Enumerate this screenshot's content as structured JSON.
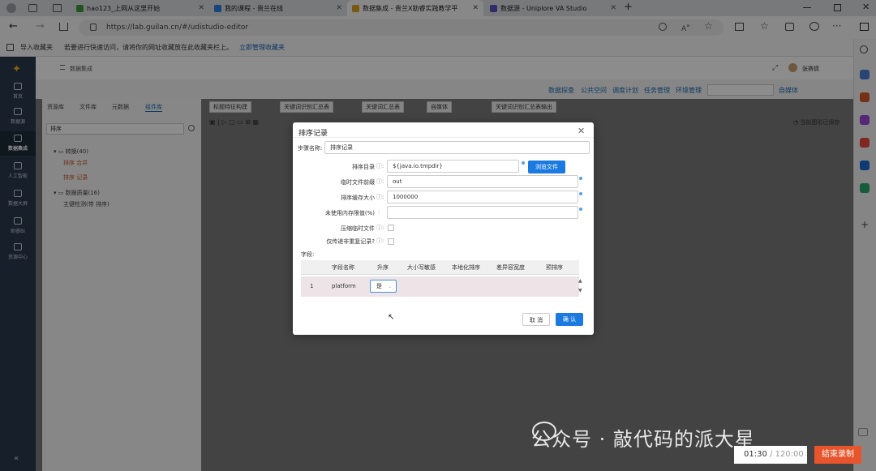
{
  "browser": {
    "tabs": [
      {
        "label": "",
        "active": false
      },
      {
        "label": "hao123_上网从这里开始",
        "active": false
      },
      {
        "label": "我的课程 - 贵兰在线",
        "active": false
      },
      {
        "label": "数据集成 - 贵兰X助睿实践教学平",
        "active": true
      },
      {
        "label": "数据源 - Uniplore VA Studio",
        "active": false
      }
    ],
    "new_tab": "+",
    "url": "https://lab.guilan.cn/#/udistudio-editor",
    "favbar": {
      "import": "导入收藏夹",
      "hint": "若要进行快速访问，请将你的网址收藏放在此收藏夹栏上。",
      "link": "立即管理收藏夹"
    }
  },
  "app": {
    "breadcrumb": "数据集成",
    "user": "张赛倩",
    "nav": [
      {
        "label": "首页"
      },
      {
        "label": "数据源"
      },
      {
        "label": "数据集成",
        "active": true
      },
      {
        "label": "人工智能"
      },
      {
        "label": "数据大屏"
      },
      {
        "label": "助睿BI"
      },
      {
        "label": "资源中心"
      }
    ],
    "menu": [
      "数据探查",
      "公共空间",
      "调度计划",
      "任务管理",
      "环境管理"
    ],
    "media": "自媒体",
    "left_tabs": [
      "资源库",
      "文件库",
      "元数据",
      "组件库"
    ],
    "search_value": "排序",
    "tree": {
      "group1": "转换(40)",
      "g1_items": [
        "排序 合并",
        "排序 记录"
      ],
      "group2": "数据质量(16)",
      "g2_items": [
        "主键检测(带 排序)"
      ]
    },
    "doc_tabs": [
      "标题特征构建",
      "关键词识别汇总表",
      "关键词汇总表",
      "自媒体",
      "关键词识别汇总表输出"
    ],
    "save_status": "当前图形已保存"
  },
  "dialog": {
    "title": "排序记录",
    "step_label": "步骤名称:",
    "step_value": "排序记录",
    "fields": [
      {
        "label": "排序目录",
        "value": "${java.io.tmpdir}"
      },
      {
        "label": "临时文件前缀",
        "value": "out"
      },
      {
        "label": "排序缓存大小",
        "value": "1000000"
      },
      {
        "label": "未使用内存限值(%)",
        "value": ""
      }
    ],
    "browse": "浏览文件",
    "checks": [
      "压缩临时文件",
      "仅传递非重复记录?"
    ],
    "fields_title": "字段:",
    "grid_headers": [
      "字段名称",
      "升序",
      "大小写敏感",
      "本地化排序",
      "差异容宽度",
      "预排序"
    ],
    "row": {
      "index": "1",
      "name": "platform",
      "asc": "是"
    },
    "cancel": "取 消",
    "ok": "确 认"
  },
  "recording": {
    "time": "01:30",
    "total": "/ 120:00",
    "end": "结束录制"
  },
  "watermark": "公众号 · 敲代码的派大星"
}
